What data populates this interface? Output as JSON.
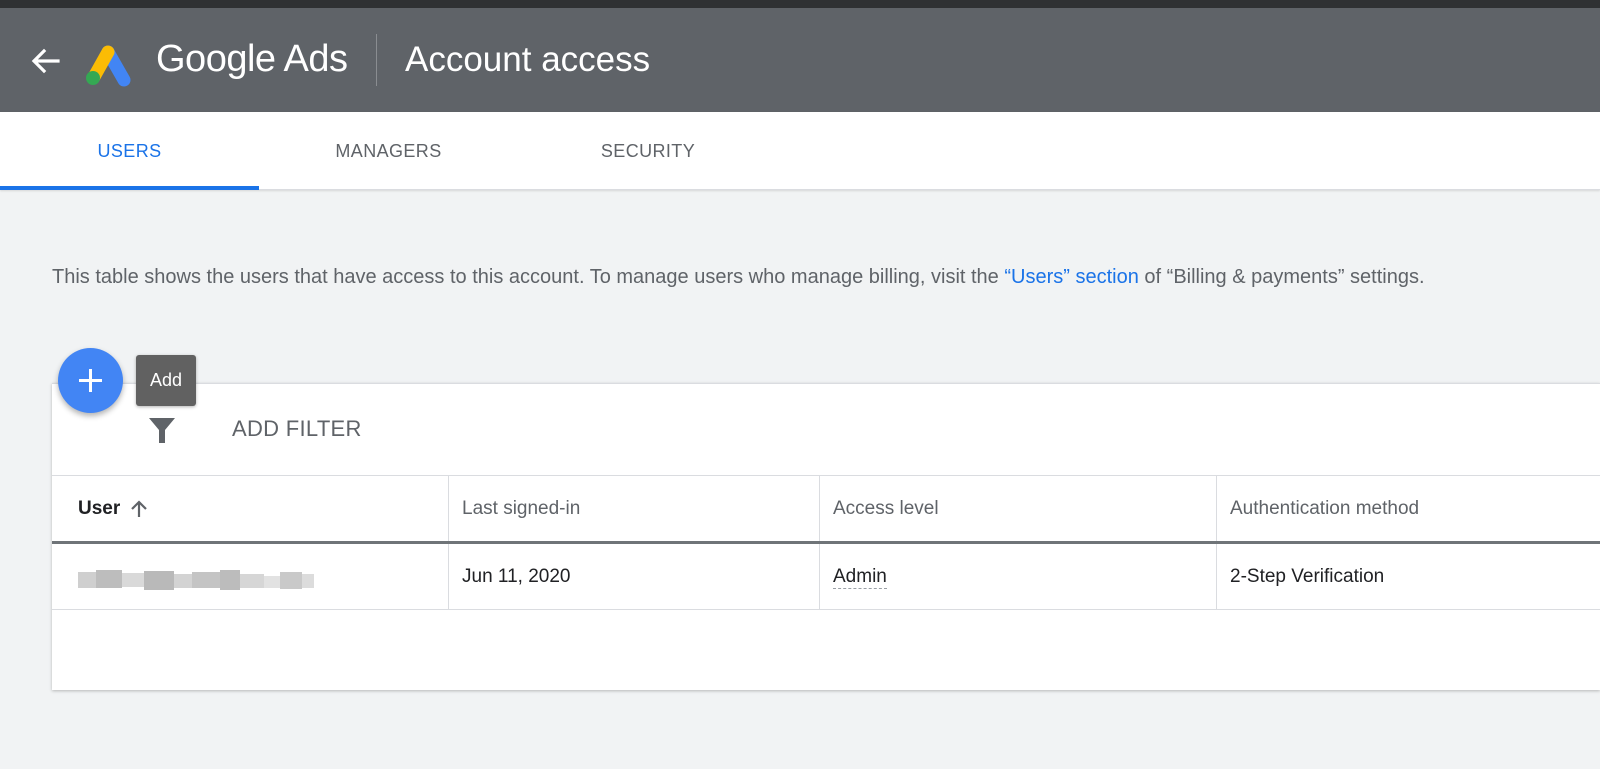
{
  "header": {
    "brand": "Google Ads",
    "title": "Account access",
    "colors": {
      "background": "#5f6368",
      "topstrip": "#2f3133"
    }
  },
  "tabs": [
    {
      "label": "USERS",
      "active": true
    },
    {
      "label": "MANAGERS",
      "active": false
    },
    {
      "label": "SECURITY",
      "active": false
    }
  ],
  "description": {
    "text_before": "This table shows the users that have access to this account. To manage users who manage billing, visit the ",
    "link": "“Users” section",
    "text_after": " of “Billing & payments” settings."
  },
  "fab": {
    "icon": "plus-icon",
    "tooltip": "Add"
  },
  "filter": {
    "icon": "filter-icon",
    "label": "ADD FILTER"
  },
  "table": {
    "columns": [
      "User",
      "Last signed-in",
      "Access level",
      "Authentication method"
    ],
    "sort": {
      "column": "User",
      "direction": "ascending",
      "icon": "arrow-up-icon"
    },
    "rows": [
      {
        "user": "",
        "user_blurred": true,
        "last_signed_in": "Jun 11, 2020",
        "access_level": "Admin",
        "auth_method": "2-Step Verification"
      }
    ]
  },
  "colors": {
    "accent": "#1a73e8",
    "fab": "#4285f4",
    "tooltip": "#616161",
    "page_bg": "#f1f3f4"
  }
}
